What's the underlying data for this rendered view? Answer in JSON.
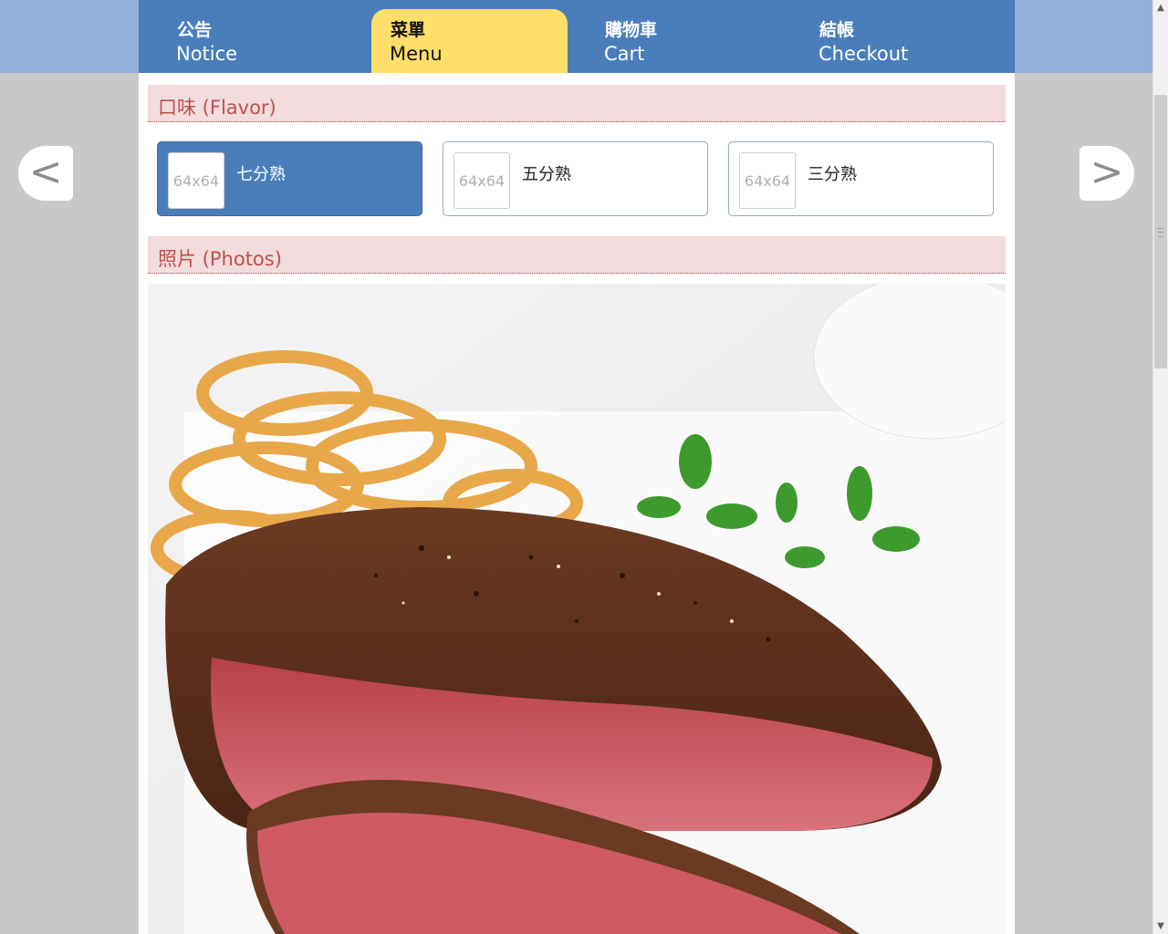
{
  "nav": {
    "tabs": [
      {
        "zh": "公告",
        "en": "Notice"
      },
      {
        "zh": "菜單",
        "en": "Menu"
      },
      {
        "zh": "購物車",
        "en": "Cart"
      },
      {
        "zh": "結帳",
        "en": "Checkout"
      }
    ],
    "active_tab": "Menu"
  },
  "flavor_section": {
    "title": "口味 (Flavor)",
    "options": [
      {
        "thumb": "64x64",
        "name": "七分熟",
        "selected": true
      },
      {
        "thumb": "64x64",
        "name": "五分熟",
        "selected": false
      },
      {
        "thumb": "64x64",
        "name": "三分熟",
        "selected": false
      }
    ]
  },
  "photos_section": {
    "title": "照片 (Photos)"
  },
  "carousel": {
    "prev": "<",
    "next": ">"
  },
  "colors": {
    "nav_bg": "#4a7ebb",
    "active_tab": "#ffdf6a",
    "section_header_bg": "#f3dcdd",
    "section_header_text": "#c0504d",
    "page_bg": "#c8c8c8"
  }
}
